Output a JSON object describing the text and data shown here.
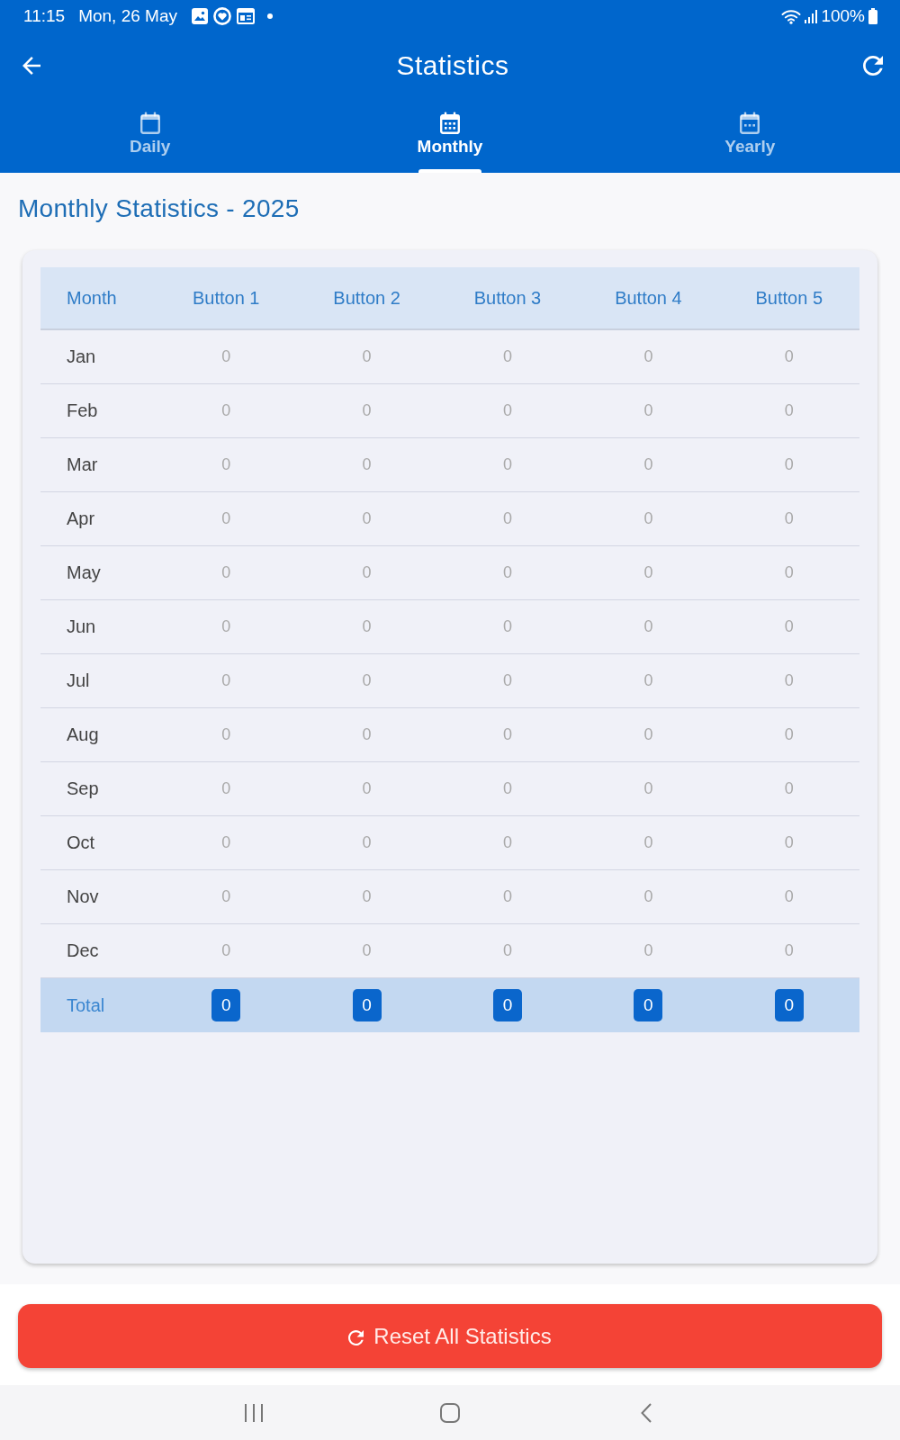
{
  "status_bar": {
    "time": "11:15",
    "date": "Mon, 26 May",
    "battery": "100%"
  },
  "app_bar": {
    "title": "Statistics"
  },
  "tabs": [
    {
      "label": "Daily",
      "selected": false
    },
    {
      "label": "Monthly",
      "selected": true
    },
    {
      "label": "Yearly",
      "selected": false
    }
  ],
  "heading": "Monthly Statistics - 2025",
  "table": {
    "columns": [
      "Month",
      "Button 1",
      "Button 2",
      "Button 3",
      "Button 4",
      "Button 5"
    ],
    "rows": [
      {
        "month": "Jan",
        "values": [
          "0",
          "0",
          "0",
          "0",
          "0"
        ]
      },
      {
        "month": "Feb",
        "values": [
          "0",
          "0",
          "0",
          "0",
          "0"
        ]
      },
      {
        "month": "Mar",
        "values": [
          "0",
          "0",
          "0",
          "0",
          "0"
        ]
      },
      {
        "month": "Apr",
        "values": [
          "0",
          "0",
          "0",
          "0",
          "0"
        ]
      },
      {
        "month": "May",
        "values": [
          "0",
          "0",
          "0",
          "0",
          "0"
        ]
      },
      {
        "month": "Jun",
        "values": [
          "0",
          "0",
          "0",
          "0",
          "0"
        ]
      },
      {
        "month": "Jul",
        "values": [
          "0",
          "0",
          "0",
          "0",
          "0"
        ]
      },
      {
        "month": "Aug",
        "values": [
          "0",
          "0",
          "0",
          "0",
          "0"
        ]
      },
      {
        "month": "Sep",
        "values": [
          "0",
          "0",
          "0",
          "0",
          "0"
        ]
      },
      {
        "month": "Oct",
        "values": [
          "0",
          "0",
          "0",
          "0",
          "0"
        ]
      },
      {
        "month": "Nov",
        "values": [
          "0",
          "0",
          "0",
          "0",
          "0"
        ]
      },
      {
        "month": "Dec",
        "values": [
          "0",
          "0",
          "0",
          "0",
          "0"
        ]
      }
    ],
    "total": {
      "label": "Total",
      "values": [
        "0",
        "0",
        "0",
        "0",
        "0"
      ]
    }
  },
  "reset_button": {
    "label": "Reset All Statistics"
  }
}
